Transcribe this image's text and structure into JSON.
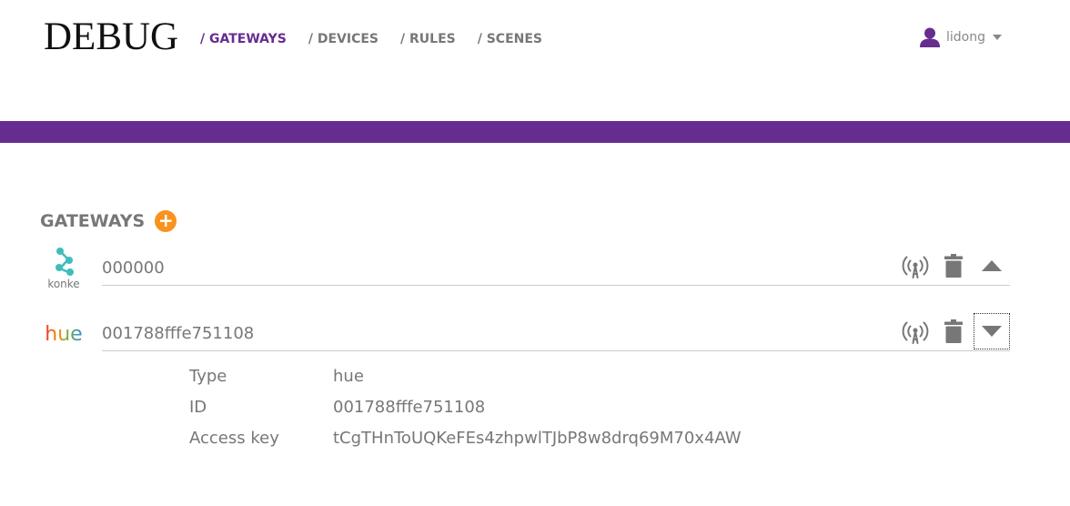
{
  "header": {
    "logo": "DEBUG",
    "nav": [
      {
        "label": "/ GATEWAYS",
        "active": true
      },
      {
        "label": "/ DEVICES",
        "active": false
      },
      {
        "label": "/ RULES",
        "active": false
      },
      {
        "label": "/ SCENES",
        "active": false
      }
    ],
    "user": {
      "name": "lidong",
      "icon": "user-icon"
    }
  },
  "colors": {
    "brand": "#662d91",
    "accent": "#f7931e",
    "text": "#777777"
  },
  "gateways_section": {
    "title": "GATEWAYS",
    "add_label": "+",
    "items": [
      {
        "logo": "konke",
        "logo_text": "konke",
        "id": "000000",
        "expanded": false,
        "icons": [
          "antenna-icon",
          "trash-icon",
          "chevron-up-icon"
        ]
      },
      {
        "logo": "hue",
        "logo_text": "hue",
        "id": "001788fffe751108",
        "expanded": true,
        "icons": [
          "antenna-icon",
          "trash-icon",
          "chevron-down-icon"
        ],
        "details": [
          {
            "label": "Type",
            "value": "hue"
          },
          {
            "label": "ID",
            "value": "001788fffe751108"
          },
          {
            "label": "Access key",
            "value": "tCgTHnToUQKeFEs4zhpwlTJbP8w8drq69M70x4AW"
          }
        ]
      }
    ]
  }
}
